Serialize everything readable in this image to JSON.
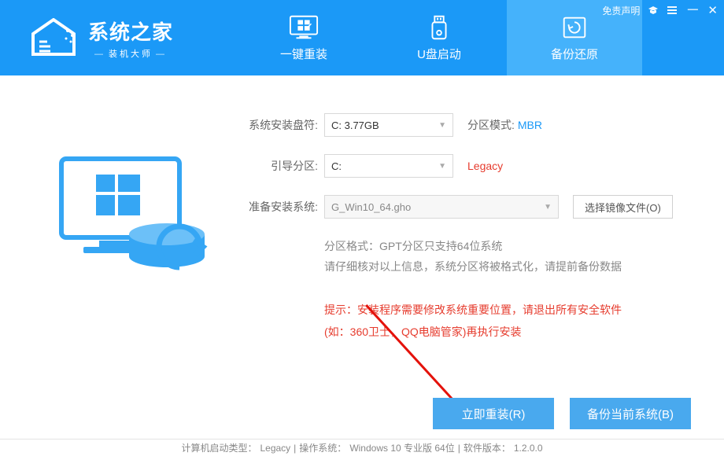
{
  "titlebar": {
    "disclaimer": "免责声明"
  },
  "brand": {
    "title": "系统之家",
    "subtitle": "装机大师"
  },
  "nav": {
    "items": [
      {
        "label": "一键重装"
      },
      {
        "label": "U盘启动"
      },
      {
        "label": "备份还原"
      }
    ]
  },
  "form": {
    "install_drive_label": "系统安装盘符:",
    "install_drive_value": "C: 3.77GB",
    "partition_mode_label": "分区模式:",
    "partition_mode_value": "MBR",
    "boot_partition_label": "引导分区:",
    "boot_partition_value": "C:",
    "boot_mode_value": "Legacy",
    "prepare_label": "准备安装系统:",
    "prepare_value": "G_Win10_64.gho",
    "choose_image_btn": "选择镜像文件(O)"
  },
  "info": {
    "line1": "分区格式：GPT分区只支持64位系统",
    "line2": "请仔细核对以上信息，系统分区将被格式化，请提前备份数据"
  },
  "warn": {
    "line1": "提示：安装程序需要修改系统重要位置，请退出所有安全软件",
    "line2": "(如：360卫士，QQ电脑管家)再执行安装"
  },
  "actions": {
    "reinstall": "立即重装(R)",
    "backup": "备份当前系统(B)"
  },
  "status": {
    "boot_type_label": "计算机启动类型：",
    "boot_type_value": "Legacy",
    "os_label": "操作系统：",
    "os_value": "Windows 10 专业版 64位",
    "ver_label": "软件版本：",
    "ver_value": "1.2.0.0"
  }
}
